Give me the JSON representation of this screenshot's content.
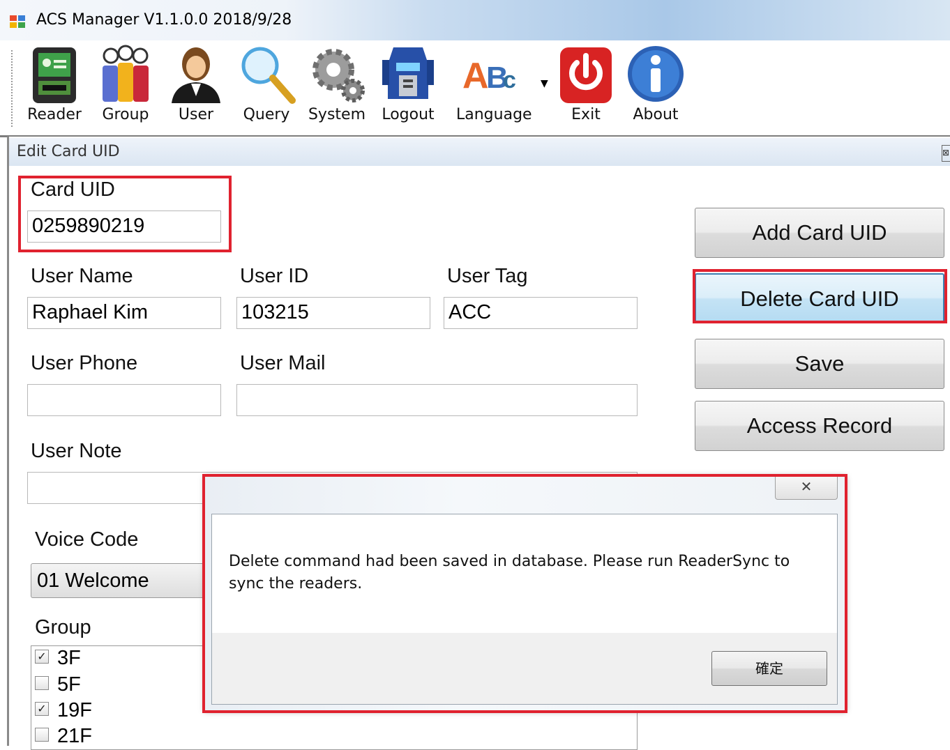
{
  "window": {
    "title": "ACS Manager V1.1.0.0  2018/9/28"
  },
  "toolbar": {
    "items": [
      {
        "label": "Reader",
        "icon": "card-reader-icon"
      },
      {
        "label": "Group",
        "icon": "group-icon"
      },
      {
        "label": "User",
        "icon": "user-icon"
      },
      {
        "label": "Query",
        "icon": "magnifier-icon"
      },
      {
        "label": "System",
        "icon": "gears-icon"
      },
      {
        "label": "Logout",
        "icon": "robot-head-icon"
      },
      {
        "label": "Language",
        "icon": "abc-language-icon"
      },
      {
        "label": "Exit",
        "icon": "power-icon"
      },
      {
        "label": "About",
        "icon": "info-icon"
      }
    ]
  },
  "panel": {
    "title": "Edit Card UID",
    "close_glyph": "⊠"
  },
  "form": {
    "card_uid": {
      "label": "Card UID",
      "value": "0259890219"
    },
    "user_name": {
      "label": "User Name",
      "value": "Raphael Kim"
    },
    "user_id": {
      "label": "User ID",
      "value": "103215"
    },
    "user_tag": {
      "label": "User Tag",
      "value": "ACC"
    },
    "user_phone": {
      "label": "User Phone",
      "value": ""
    },
    "user_mail": {
      "label": "User Mail",
      "value": ""
    },
    "user_note": {
      "label": "User Note",
      "value": ""
    },
    "voice_code": {
      "label": "Voice Code",
      "selected": "01 Welcome"
    },
    "group": {
      "label": "Group",
      "items": [
        {
          "label": "3F",
          "checked": true
        },
        {
          "label": "5F",
          "checked": false
        },
        {
          "label": "19F",
          "checked": true
        },
        {
          "label": "21F",
          "checked": false
        }
      ]
    }
  },
  "actions": {
    "add": "Add Card UID",
    "delete": "Delete Card UID",
    "save": "Save",
    "access_record": "Access Record"
  },
  "dialog": {
    "message_line1": "Delete command had been saved in database. Please run ReaderSync to",
    "message_line2": "sync the readers.",
    "ok_label": "確定",
    "close_glyph": "✕"
  },
  "colors": {
    "highlight_red": "#e0222f",
    "focus_blue": "#3c7fb1"
  }
}
